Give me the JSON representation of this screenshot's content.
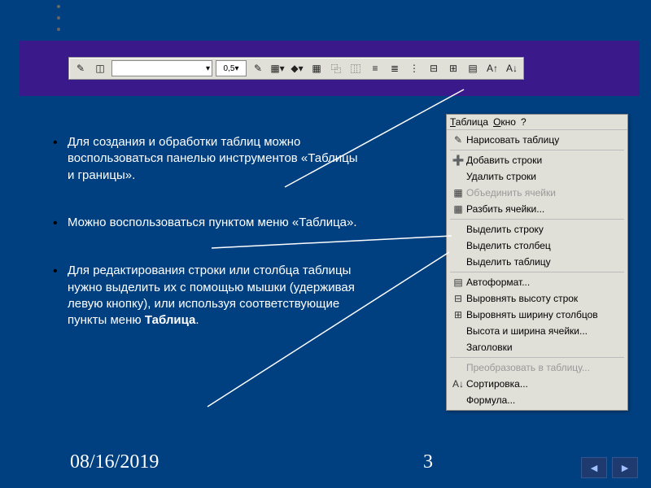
{
  "toolbar": {
    "line_width": "0,5"
  },
  "bullets": {
    "b1": "Для создания и обработки таблиц можно воспользоваться панелью инструментов «Таблицы и границы».",
    "b2": "Можно воспользоваться пунктом меню «Таблица».",
    "b3_a": "Для редактирования строки или столбца таблицы нужно выделить их с помощью мышки (удерживая левую кнопку), или используя соответствующие пункты меню ",
    "b3_b": "Таблица",
    "b3_c": "."
  },
  "menu_bar": {
    "m1": "Таблица",
    "m2": "Окно",
    "m3": "?"
  },
  "menu": {
    "draw_table": "Нарисовать таблицу",
    "add_rows": "Добавить строки",
    "del_rows": "Удалить строки",
    "merge_cells": "Объединить ячейки",
    "split_cells": "Разбить ячейки...",
    "select_row": "Выделить строку",
    "select_col": "Выделить столбец",
    "select_table": "Выделить таблицу",
    "autoformat": "Автоформат...",
    "dist_rows": "Выровнять высоту строк",
    "dist_cols": "Выровнять ширину столбцов",
    "rowcol_size": "Высота и ширина ячейки...",
    "headings": "Заголовки",
    "convert": "Преобразовать в таблицу...",
    "sort": "Сортировка...",
    "formula": "Формула..."
  },
  "footer": {
    "date": "08/16/2019",
    "page": "3"
  }
}
